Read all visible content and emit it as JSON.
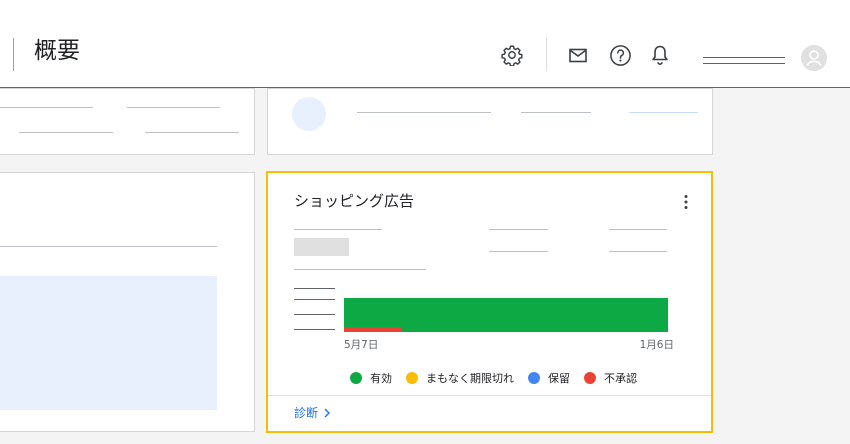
{
  "header": {
    "title": "概要",
    "icons": [
      "gear-icon",
      "mail-icon",
      "help-icon",
      "bell-icon",
      "account-avatar-icon"
    ]
  },
  "shopping_card": {
    "title": "ショッピング広告",
    "chart": {
      "start_label": "5月7日",
      "end_label": "1月6日"
    },
    "legend": [
      {
        "label": "有効",
        "color": "#0ca944"
      },
      {
        "label": "まもなく期限切れ",
        "color": "#fbbc04"
      },
      {
        "label": "保留",
        "color": "#4285f4"
      },
      {
        "label": "不承認",
        "color": "#ea4335"
      }
    ],
    "link_label": "診断"
  },
  "colors": {
    "accent_border": "#fbbc04",
    "link": "#1a73e8"
  }
}
